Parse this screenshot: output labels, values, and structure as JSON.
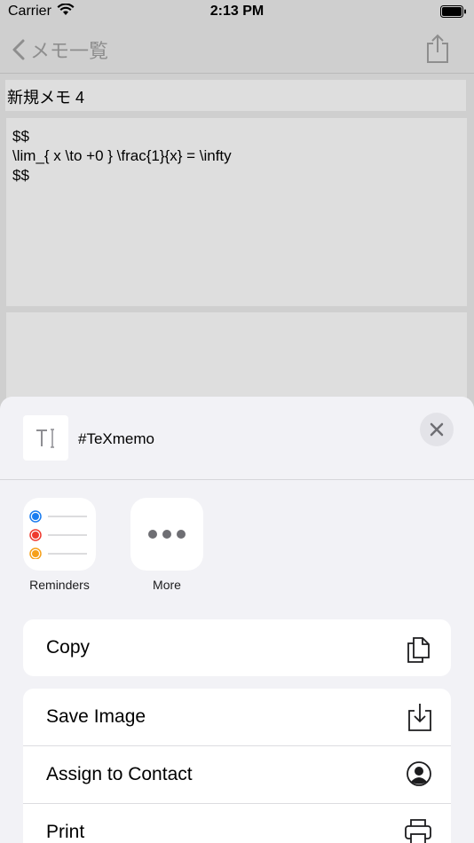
{
  "status_bar": {
    "carrier": "Carrier",
    "time": "2:13 PM"
  },
  "nav": {
    "back_label": "メモ一覧"
  },
  "memo": {
    "title": "新規メモ 4",
    "body_lines": [
      "$$",
      "\\lim_{ x \\to +0 } \\frac{1}{x} = \\infty",
      "$$"
    ]
  },
  "share_sheet": {
    "title": "#TeXmemo",
    "apps": [
      {
        "label": "Reminders",
        "icon": "reminders-icon"
      },
      {
        "label": "More",
        "icon": "more-icon"
      }
    ],
    "actions_group1": [
      {
        "label": "Copy",
        "icon": "copy-icon"
      }
    ],
    "actions_group2": [
      {
        "label": "Save Image",
        "icon": "save-image-icon"
      },
      {
        "label": "Assign to Contact",
        "icon": "contact-icon"
      },
      {
        "label": "Print",
        "icon": "print-icon"
      }
    ]
  },
  "colors": {
    "accent": "#8e8e93",
    "reminder_blue": "#1a7cf0",
    "reminder_red": "#ef3a2f",
    "reminder_orange": "#f6a019"
  }
}
